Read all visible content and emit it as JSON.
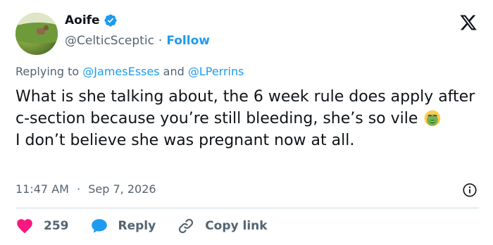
{
  "author": {
    "display_name": "Aoife",
    "handle": "@CelticSceptic",
    "separator": "·",
    "follow_label": "Follow",
    "verified": true,
    "avatar_icon": "avatar-image"
  },
  "reply": {
    "prefix": "Replying to",
    "mentions": [
      "@JamesEsses",
      "@LPerrins"
    ],
    "conjunction": "and"
  },
  "tweet": {
    "lines": [
      "What is she talking about, the 6 week rule does apply after c-section because you’re still bleeding, she’s so vile",
      "I don’t believe she was pregnant now at all."
    ],
    "emoji_name": "nauseated-face-emoji"
  },
  "meta": {
    "time": "11:47 AM",
    "separator": "·",
    "date": "Sep 7, 2026",
    "info_icon": "info-icon"
  },
  "actions": {
    "like_count": "259",
    "reply_label": "Reply",
    "copy_link_label": "Copy link"
  },
  "brand": {
    "logo_icon": "x-logo-icon"
  },
  "colors": {
    "accent": "#1d9bf0",
    "like": "#f91880",
    "text": "#0f1419",
    "muted": "#536471",
    "divider": "#cfd9de"
  }
}
